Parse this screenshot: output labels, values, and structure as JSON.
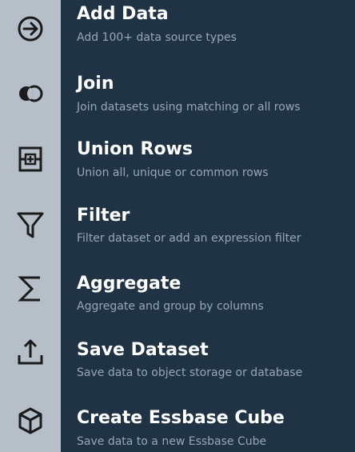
{
  "menu": {
    "items": [
      {
        "id": "add-data",
        "title": "Add Data",
        "description": "Add 100+ data source types",
        "icon": "arrow-right-circle-icon"
      },
      {
        "id": "join",
        "title": "Join",
        "description": "Join datasets using matching or all rows",
        "icon": "join-icon"
      },
      {
        "id": "union-rows",
        "title": "Union Rows",
        "description": "Union all, unique or common rows",
        "icon": "union-rows-icon"
      },
      {
        "id": "filter",
        "title": "Filter",
        "description": "Filter dataset or add an expression filter",
        "icon": "filter-icon"
      },
      {
        "id": "aggregate",
        "title": "Aggregate",
        "description": "Aggregate and group by columns",
        "icon": "sigma-icon"
      },
      {
        "id": "save-dataset",
        "title": "Save Dataset",
        "description": "Save data to object storage or database",
        "icon": "upload-icon"
      },
      {
        "id": "create-essbase-cube",
        "title": "Create Essbase Cube",
        "description": "Save data to a new Essbase Cube",
        "icon": "cube-icon"
      }
    ]
  },
  "colors": {
    "background": "#1f3345",
    "icon_gutter": "#b6bfc7",
    "title_text": "#ffffff",
    "description_text": "#9aa7b3",
    "icon_stroke": "#1b1b1b"
  }
}
